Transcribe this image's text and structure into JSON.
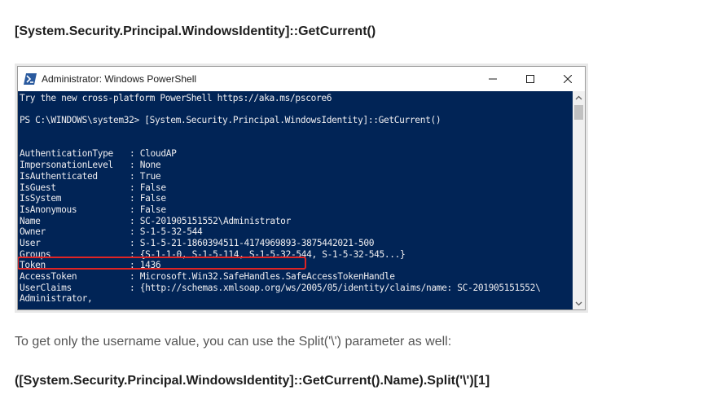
{
  "article": {
    "heading_top": "[System.Security.Principal.WindowsIdentity]::GetCurrent()",
    "paragraph": "To get only the username value, you can use the Split('\\') parameter as well:",
    "heading_bottom": "([System.Security.Principal.WindowsIdentity]::GetCurrent().Name).Split('\\')[1]"
  },
  "window": {
    "title": "Administrator: Windows PowerShell",
    "icon": "powershell-icon",
    "buttons": [
      "minimize-icon",
      "maximize-icon",
      "close-icon"
    ]
  },
  "console": {
    "banner": "Try the new cross-platform PowerShell https://aka.ms/pscore6",
    "prompt": "PS C:\\WINDOWS\\system32> ",
    "command": "[System.Security.Principal.WindowsIdentity]::GetCurrent()",
    "properties": [
      {
        "name": "AuthenticationType",
        "value": ": CloudAP"
      },
      {
        "name": "ImpersonationLevel",
        "value": ": None"
      },
      {
        "name": "IsAuthenticated",
        "value": ": True"
      },
      {
        "name": "IsGuest",
        "value": ": False"
      },
      {
        "name": "IsSystem",
        "value": ": False"
      },
      {
        "name": "IsAnonymous",
        "value": ": False"
      },
      {
        "name": "Name",
        "value": ": SC-201905151552\\Administrator"
      },
      {
        "name": "Owner",
        "value": ": S-1-5-32-544"
      },
      {
        "name": "User",
        "value": ": S-1-5-21-1860394511-4174969893-3875442021-500"
      },
      {
        "name": "Groups",
        "value": ": {S-1-1-0, S-1-5-114, S-1-5-32-544, S-1-5-32-545...}"
      },
      {
        "name": "Token",
        "value": ": 1436"
      },
      {
        "name": "AccessToken",
        "value": ": Microsoft.Win32.SafeHandles.SafeAccessTokenHandle"
      },
      {
        "name": "UserClaims",
        "value": ": {http://schemas.xmlsoap.org/ws/2005/05/identity/claims/name: SC-201905151552\\"
      }
    ],
    "wrap_line": "Administrator,"
  },
  "colors": {
    "console_bg": "#012456",
    "console_text": "#eeedf0",
    "highlight": "#e02424"
  }
}
